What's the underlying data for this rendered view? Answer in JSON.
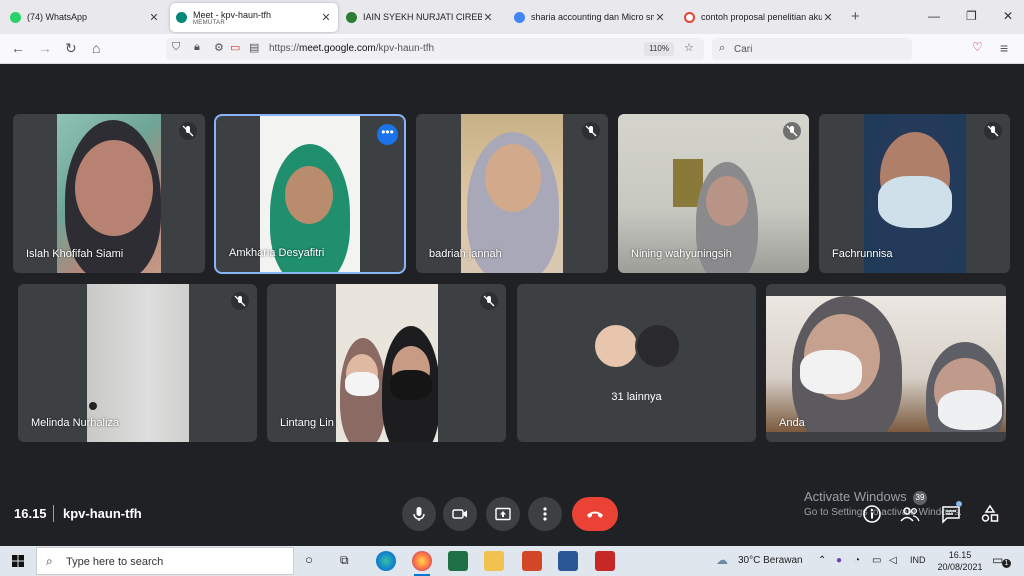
{
  "browser": {
    "tabs": [
      {
        "label": "(74) WhatsApp",
        "icon": "whatsapp-icon",
        "color": "#25d366"
      },
      {
        "label": "Meet - kpv-haun-tfh",
        "sub": "MEMUTAR",
        "icon": "meet-icon",
        "color": "#00897b",
        "active": true
      },
      {
        "label": "IAIN SYEKH NURJATI CIREBON",
        "icon": "iain-icon",
        "color": "#2e7d32"
      },
      {
        "label": "sharia accounting dan Micro sm",
        "icon": "scholar-icon",
        "color": "#4285f4"
      },
      {
        "label": "contoh proposal penelitian aku",
        "icon": "google-icon",
        "color": "#ea4335"
      }
    ],
    "url_prefix": "https://",
    "url_domain": "meet.google.com",
    "url_path": "/kpv-haun-tfh",
    "zoom": "110%",
    "search_placeholder": "Cari"
  },
  "meet": {
    "participants": [
      {
        "name": "Islah Khofifah Siami",
        "muted": true
      },
      {
        "name": "Amkhana Desyafitri",
        "muted": false,
        "active": true
      },
      {
        "name": "badriah jannah",
        "muted": true
      },
      {
        "name": "Nining wahyuningsih",
        "muted": true
      },
      {
        "name": "Fachrunnisa",
        "muted": true
      },
      {
        "name": "Melinda Nurhaliza",
        "muted": true
      },
      {
        "name": "Lintang Lin",
        "muted": true
      },
      {
        "name": "Anda",
        "muted": false
      }
    ],
    "others_label": "31 lainnya",
    "time": "16.15",
    "meeting_code": "kpv-haun-tfh",
    "participant_count": "39",
    "end_call_color": "#ea4335",
    "active_speaker_color": "#8ab4f8"
  },
  "watermark": {
    "line1": "Activate Windows",
    "line2": "Go to Settings to activate Windows."
  },
  "taskbar": {
    "search_placeholder": "Type here to search",
    "weather": "30°C  Berawan",
    "language": "IND",
    "time": "16.15",
    "date": "20/08/2021",
    "notification_count": "1"
  }
}
